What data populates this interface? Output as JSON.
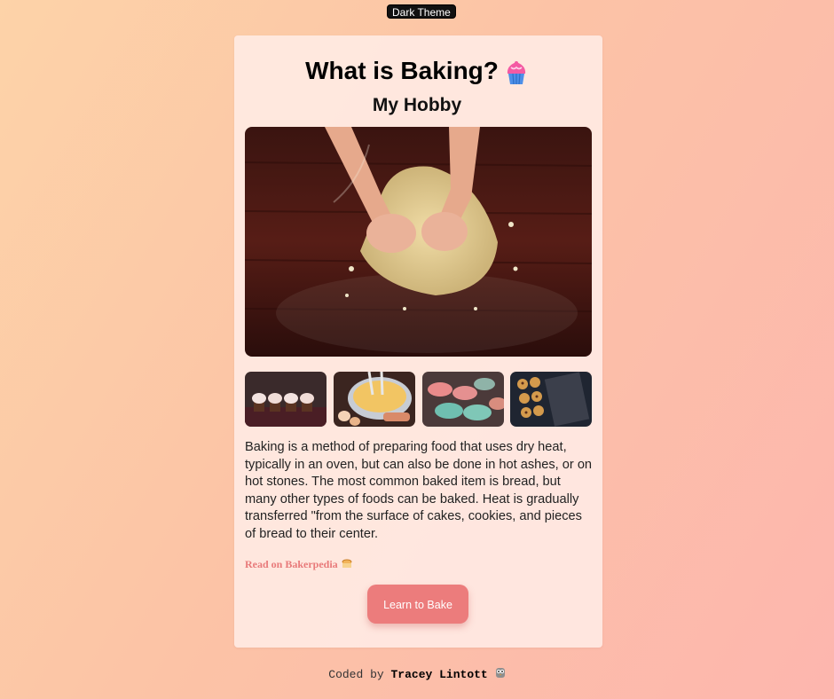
{
  "theme_toggle": {
    "label": "Dark Theme"
  },
  "header": {
    "title": "What is Baking?",
    "title_icon": "cupcake-icon",
    "subtitle": "My Hobby"
  },
  "hero_image": {
    "subject": "hands-kneading-dough"
  },
  "gallery": [
    {
      "subject": "cupcakes"
    },
    {
      "subject": "mixing-bowl"
    },
    {
      "subject": "macarons"
    },
    {
      "subject": "muffin-tray"
    }
  ],
  "description": "Baking is a method of preparing food that uses dry heat, typically in an oven, but can also be done in hot ashes, or on hot stones. The most common baked item is bread, but many other types of foods can be baked. Heat is gradually transferred \"from the surface of cakes, cookies, and pieces of bread to their center.",
  "read_link": {
    "label": "Read on Bakerpedia",
    "icon": "bread-icon"
  },
  "cta": {
    "label": "Learn to Bake"
  },
  "footer": {
    "prefix": "Coded by",
    "author": "Tracey Lintott",
    "icon": "owl-icon"
  },
  "colors": {
    "accent": "#ec7c7c",
    "link": "#e87a7a",
    "card": "#ffece6"
  }
}
